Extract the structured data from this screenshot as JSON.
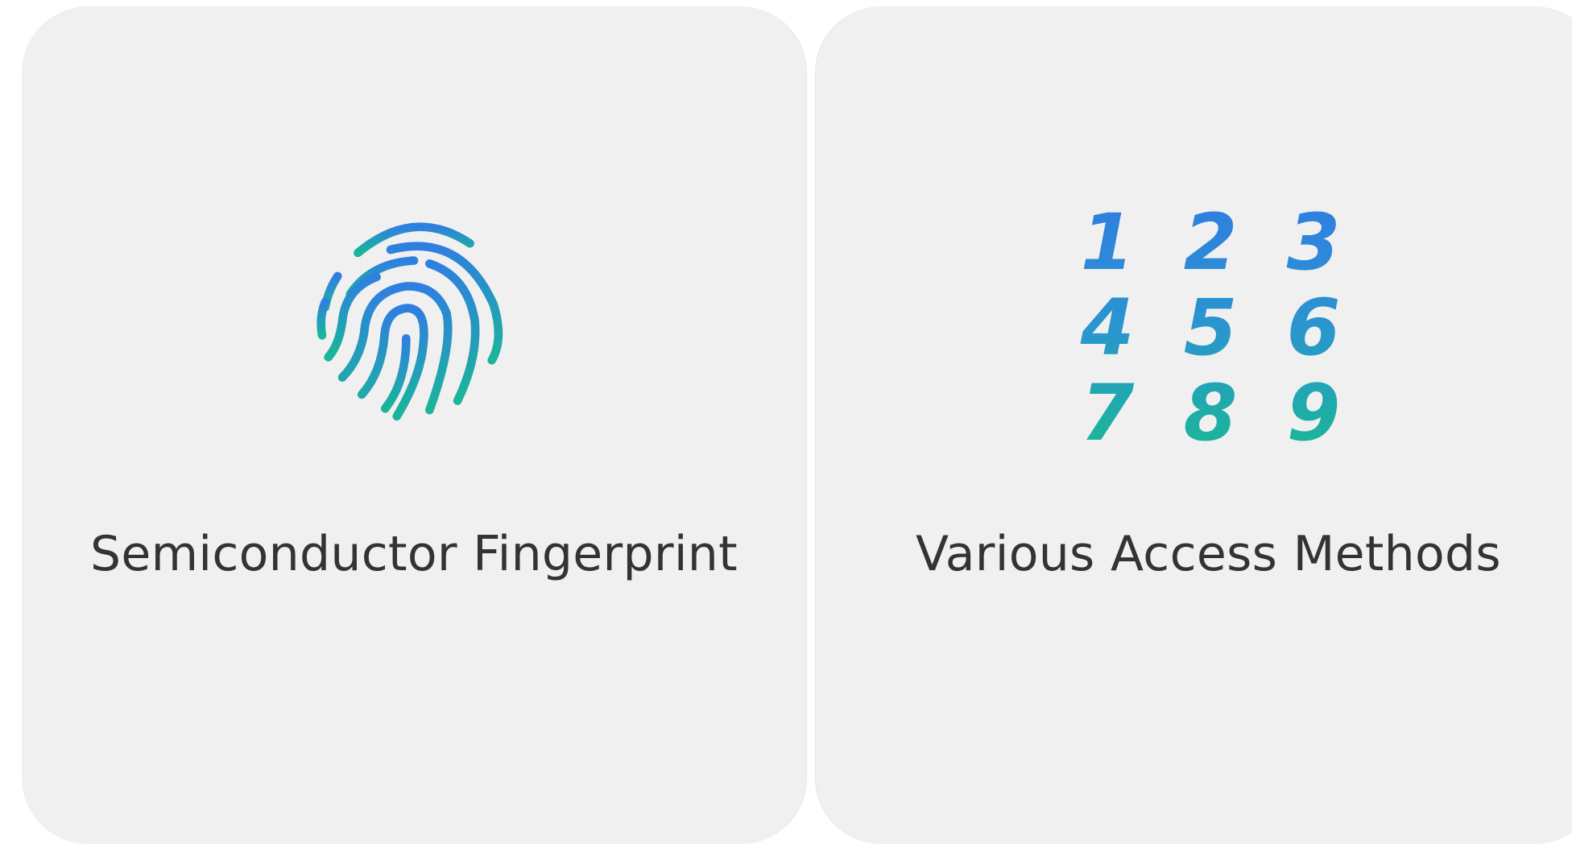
{
  "features": [
    {
      "title": "Semiconductor Fingerprint",
      "icon": "fingerprint-icon"
    },
    {
      "title": "Various Access Methods",
      "icon": "keypad-icon",
      "keys": [
        "1",
        "2",
        "3",
        "4",
        "5",
        "6",
        "7",
        "8",
        "9"
      ]
    }
  ],
  "colors": {
    "card_background": "#f0f0f0",
    "title_text": "#333333",
    "gradient_top": "#2f7fe0",
    "gradient_bottom": "#1ab59a"
  }
}
